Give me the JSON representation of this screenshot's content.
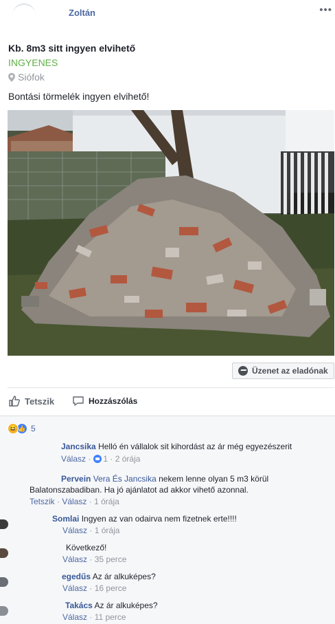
{
  "post": {
    "author": "Zoltán",
    "title": "Kb. 8m3 sitt ingyen elvihető",
    "price": "INGYENES",
    "location": "Siófok",
    "description": "Bontási törmelék ingyen elvihető!"
  },
  "actions": {
    "message_seller": "Üzenet az eladónak",
    "like": "Tetszik",
    "comment": "Hozzászólás"
  },
  "reactions": {
    "count": "5"
  },
  "comments": [
    {
      "name": "Jancsika",
      "text": "Helló én vállalok sit kihordást az ár még egyezészerit",
      "reply": "Válasz",
      "likes": "1",
      "time": "2 órája"
    },
    {
      "name": "Pervein",
      "mention": "Vera És Jancsika",
      "text": "nekem lenne olyan 5 m3 körül",
      "text2": "Balatonszabadiban. Ha jó ajánlatot ad akkor vihető azonnal.",
      "like": "Tetszik",
      "reply": "Válasz",
      "time": "1 órája"
    },
    {
      "name": "Somlai",
      "text": "Ingyen az van odairva nem fizetnek erte!!!!",
      "reply": "Válasz",
      "time": "1 órája"
    },
    {
      "text": "Következő!",
      "reply": "Válasz",
      "time": "35 perce"
    },
    {
      "name": "egedűs",
      "text": "Az ár alkuképes?",
      "reply": "Válasz",
      "time": "16 perce"
    },
    {
      "name": "Takács",
      "text": "Az ár alkuképes?",
      "reply": "Válasz",
      "time": "11 perce"
    }
  ],
  "colors": {
    "link": "#385898",
    "price_green": "#5fb046",
    "muted": "#90949c"
  },
  "icons": [
    "more-icon",
    "location-pin-icon",
    "messenger-icon",
    "like-icon",
    "comment-icon",
    "haha-reaction-icon",
    "like-reaction-icon"
  ]
}
